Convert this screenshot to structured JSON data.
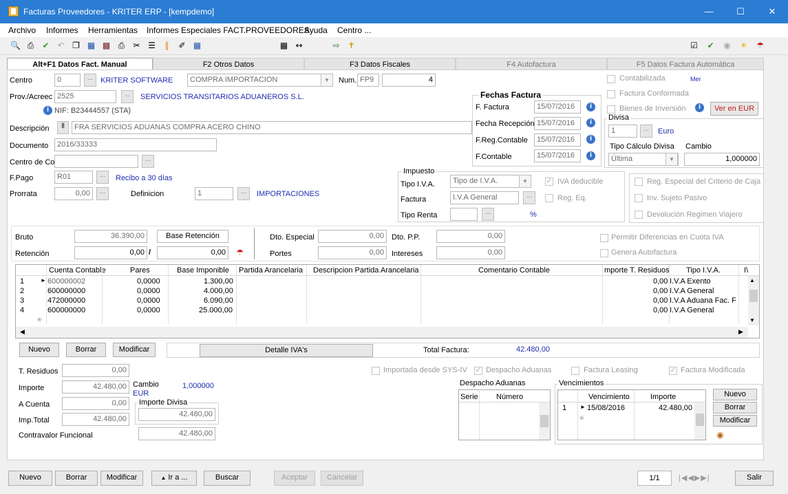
{
  "window": {
    "title": "Facturas Proveedores  - KRITER ERP - [kempdemo]"
  },
  "menu": [
    "Archivo",
    "Informes",
    "Herramientas",
    "Informes Especiales FACT.PROVEEDORES",
    "Ayuda",
    "Centro ..."
  ],
  "tabs": [
    "Alt+F1 Datos Fact. Manual",
    "F2 Otros Datos",
    "F3 Datos Fiscales",
    "F4 Autofactura",
    "F5 Datos Factura Automática"
  ],
  "form": {
    "centro_label": "Centro",
    "centro_value": "0",
    "centro_name": "KRITER SOFTWARE",
    "tipo_compra": "COMPRA IMPORTACION",
    "num_label": "Num.",
    "num_serie": "FP9",
    "num_value": "4",
    "prov_label": "Prov./Acreec",
    "prov_value": "2525",
    "prov_name": "SERVICIOS TRANSITARIOS ADUANEROS S.L.",
    "nif": "NIF:  B23444557 (STA)",
    "descripcion_label": "Descripción",
    "descripcion_value": "FRA SERVICIOS ADUANAS COMPRA ACERO CHINO",
    "documento_label": "Documento",
    "documento_value": "2016/33333",
    "centro_coste_label": "Centro de Co",
    "fpago_label": "F.Pago",
    "fpago_value": "R01",
    "fpago_desc": "Recibo a 30 días",
    "prorrata_label": "Prorrata",
    "prorrata_value": "0,00",
    "definicion_label": "Definicion",
    "definicion_value": "1",
    "definicion_name": "IMPORTACIONES"
  },
  "fechas": {
    "title": "Fechas Factura",
    "f_factura_label": "F. Factura",
    "f_factura": "15/07/2016",
    "f_recepcion_label": "Fecha Recepción",
    "f_recepcion": "15/07/2016",
    "f_reg_label": "F.Reg.Contable",
    "f_reg": "15/07/2016",
    "f_contable_label": "F.Contable",
    "f_contable": "15/07/2016"
  },
  "flags": {
    "contabilizada": "Contabilizada",
    "conformada": "Factura Conformada",
    "bienes": "Bienes de Inversión",
    "ver_eur": "Ver en EUR",
    "mer": "Mer"
  },
  "divisa": {
    "title": "Divisa",
    "value": "1",
    "name": "Euro",
    "tipo_label": "Tipo Cálculo Divisa",
    "tipo_value": "Última",
    "cambio_label": "Cambio",
    "cambio_value": "1,000000"
  },
  "impuesto": {
    "title": "Impuesto",
    "tipo_iva_label": "Tipo I.V.A.",
    "tipo_iva_value": "Tipo de I.V.A.",
    "factura_label": "Factura",
    "factura_value": "I.V.A General",
    "tipo_renta_label": "Tipo Renta",
    "percent": "%",
    "iva_deducible": "IVA deducible",
    "reg_eq": "Reg. Eq.",
    "reg_especial": "Reg. Especial del Criterio de Caja",
    "inv_sujeto": "Inv. Sujeto Pasivo",
    "devolucion": "Devolución Regimen Viajero"
  },
  "totales": {
    "bruto_label": "Bruto",
    "bruto": "36.390,00",
    "base_retencion_label": "Base Retención",
    "retencion_label": "Retención",
    "retencion_pct": "0,00",
    "retencion_val": "0,00",
    "dto_especial_label": "Dto. Especial",
    "dto_especial": "0,00",
    "dto_pp_label": "Dto. P.P.",
    "dto_pp": "0,00",
    "portes_label": "Portes",
    "portes": "0,00",
    "intereses_label": "Intereses",
    "intereses": "0,00",
    "permitir": "Permitir Diferencias en Cuota IVA",
    "genera": "Genera Autofactura"
  },
  "grid": {
    "columns": [
      "Cuenta Contable",
      "Pares",
      "Base Imponible",
      "Partida Arancelaria",
      "Descripcion Partida Arancelaria",
      "Comentario Contable",
      "mporte T. Residuos",
      "Tipo I.V.A.",
      "I\\"
    ],
    "rows": [
      {
        "n": "1",
        "cuenta": "600000002",
        "pares": "0,0000",
        "base": "1.300,00",
        "residuos": "0,00",
        "iva": "I.V.A Exento"
      },
      {
        "n": "2",
        "cuenta": "600000000",
        "pares": "0,0000",
        "base": "4.000,00",
        "residuos": "0,00",
        "iva": "I.V.A General"
      },
      {
        "n": "3",
        "cuenta": "472000000",
        "pares": "0,0000",
        "base": "6.090,00",
        "residuos": "0,00",
        "iva": "I.V.A Aduana Fac. F"
      },
      {
        "n": "4",
        "cuenta": "600000000",
        "pares": "0,0000",
        "base": "25.000,00",
        "residuos": "0,00",
        "iva": "I.V.A General"
      }
    ]
  },
  "grid_buttons": {
    "nuevo": "Nuevo",
    "borrar": "Borrar",
    "modificar": "Modificar",
    "detalle": "Detalle IVA's",
    "total_label": "Total Factura:",
    "total_value": "42.480,00"
  },
  "lower": {
    "residuos_label": "T. Residuos",
    "residuos": "0,00",
    "importe_label": "Importe",
    "importe": "42.480,00",
    "cuenta_label": "A Cuenta",
    "cuenta": "0,00",
    "imp_total_label": "Imp.Total",
    "imp_total": "42.480,00",
    "contravalor_label": "Contravalor Funcional",
    "contravalor": "42.480,00",
    "cambio_label": "Cambio",
    "cambio_cur": "EUR",
    "cambio_value": "1,000000",
    "importe_divisa_label": "Importe Divisa",
    "importe_divisa": "42.480,00"
  },
  "lower_flags": {
    "importada": "Importada desde SYS-IV",
    "despacho": "Despacho Aduanas",
    "leasing": "Factura Leasing",
    "modificada": "Factura Modificada"
  },
  "despacho": {
    "title": "Despacho Aduanas",
    "serie": "Serie",
    "numero": "Número"
  },
  "vencimientos": {
    "title": "Vencimientos",
    "col_venc": "Vencimiento",
    "col_imp": "Importe",
    "row_n": "1",
    "row_fecha": "15/08/2016",
    "row_importe": "42.480,00",
    "nuevo": "Nuevo",
    "borrar": "Borrar",
    "modificar": "Modificar"
  },
  "status": {
    "nuevo": "Nuevo",
    "borrar": "Borrar",
    "modificar": "Modificar",
    "ira": "Ir a ...",
    "buscar": "Buscar",
    "aceptar": "Aceptar",
    "cancelar": "Cancelar",
    "pagina": "1/1",
    "salir": "Salir"
  }
}
